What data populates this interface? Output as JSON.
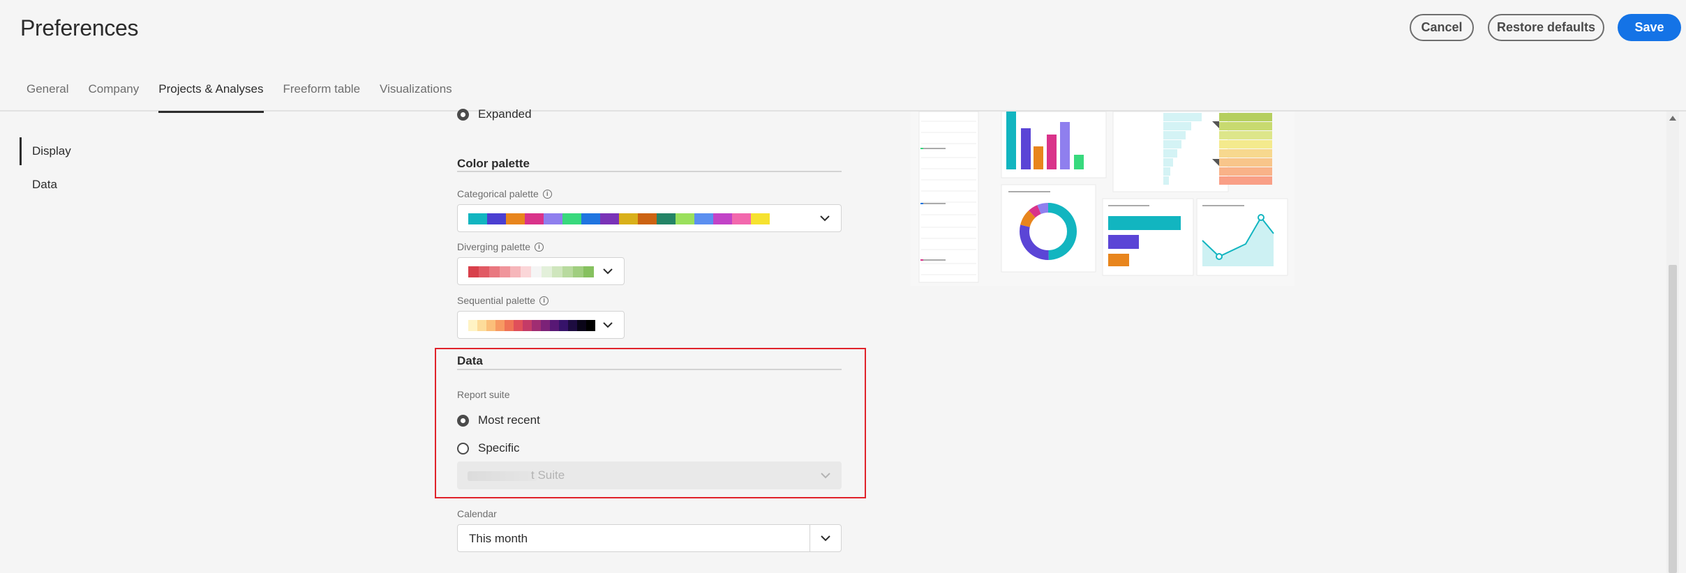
{
  "header": {
    "title": "Preferences",
    "cancel_label": "Cancel",
    "restore_label": "Restore defaults",
    "save_label": "Save"
  },
  "tabs": [
    {
      "label": "General"
    },
    {
      "label": "Company"
    },
    {
      "label": "Projects & Analyses",
      "active": true
    },
    {
      "label": "Freeform table"
    },
    {
      "label": "Visualizations"
    }
  ],
  "sidenav": {
    "items": [
      {
        "label": "Display",
        "active": true
      },
      {
        "label": "Data"
      }
    ]
  },
  "display": {
    "expanded_label": "Expanded",
    "color_palette_title": "Color palette",
    "categorical_label": "Categorical palette",
    "diverging_label": "Diverging palette",
    "sequential_label": "Sequential palette",
    "categorical_colors": [
      "#12b5c0",
      "#4b3fd1",
      "#e8851d",
      "#d9338a",
      "#8f7fee",
      "#38d97d",
      "#2075e0",
      "#7a33b7",
      "#d9b01a",
      "#cc6312",
      "#248466",
      "#9ae05c",
      "#5b8ff0",
      "#c243c7",
      "#f268ad",
      "#f6e22f"
    ],
    "diverging_colors": [
      "#d8404b",
      "#e15a64",
      "#e9777f",
      "#f0959b",
      "#f6b6ba",
      "#fbd6d8",
      "#f5f5f5",
      "#e3f0da",
      "#cfe6bd",
      "#b8da9e",
      "#a0ce7f",
      "#86c15f"
    ],
    "sequential_colors": [
      "#fff3c4",
      "#fddc9a",
      "#fbbf7a",
      "#f79a62",
      "#ef7356",
      "#e04f5a",
      "#c43b67",
      "#a02d72",
      "#7c2278",
      "#581875",
      "#36136a",
      "#1d0c40",
      "#0a0518",
      "#000000"
    ]
  },
  "data_section": {
    "title": "Data",
    "report_suite_label": "Report suite",
    "most_recent_label": "Most recent",
    "specific_label": "Specific",
    "specific_value": "t Suite",
    "calendar_label": "Calendar",
    "calendar_value": "This month"
  },
  "preview_colors": {
    "teal": "#12b5c0",
    "purple": "#5b45d6",
    "orange": "#e8851d",
    "pink": "#d9338a",
    "lavender": "#8f7fee",
    "green": "#38d97d"
  }
}
